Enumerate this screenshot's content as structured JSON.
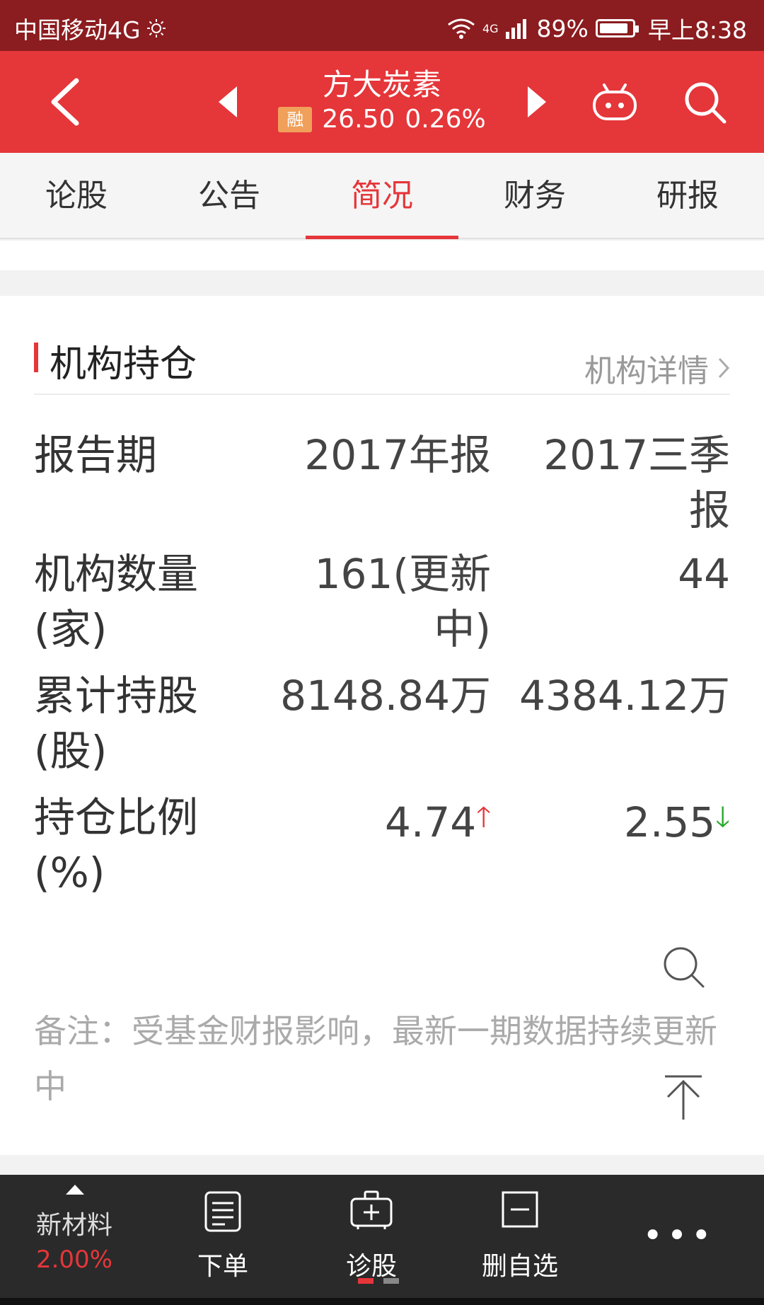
{
  "status_bar": {
    "carrier": "中国移动4G",
    "network": "4G",
    "battery": "89%",
    "battery_level": 0.89,
    "time": "早上8:38"
  },
  "header": {
    "stock_name": "方大炭素",
    "badge": "融",
    "price": "26.50",
    "change_pct": "0.26%"
  },
  "tabs": [
    {
      "label": "论股"
    },
    {
      "label": "公告"
    },
    {
      "label": "简况",
      "active": true
    },
    {
      "label": "财务"
    },
    {
      "label": "研报"
    }
  ],
  "section": {
    "title": "机构持仓",
    "detail_link": "机构详情"
  },
  "table": {
    "header": {
      "label": "报告期",
      "col1": "2017年报",
      "col2": "2017三季报"
    },
    "rows": [
      {
        "label": "机构数量(家)",
        "col1": "161(更新中)",
        "col2": "44"
      },
      {
        "label": "累计持股(股)",
        "col1": "8148.84万",
        "col2": "4384.12万"
      },
      {
        "label": "持仓比例(%)",
        "col1": "4.74",
        "col1_trend": "up",
        "col2": "2.55",
        "col2_trend": "down"
      }
    ]
  },
  "note": "备注：受基金财报影响，最新一期数据持续更新中",
  "bottom_bar": {
    "sector_name": "新材料",
    "sector_pct": "2.00%",
    "order_label": "下单",
    "diagnose_label": "诊股",
    "remove_label": "删自选",
    "more_label": "•••"
  },
  "colors": {
    "brand_red": "#e5363a",
    "status_bar": "#8b1c1f",
    "up": "#e5363a",
    "down": "#23a829"
  }
}
